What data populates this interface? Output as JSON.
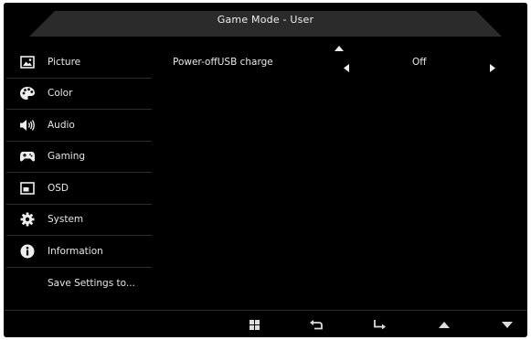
{
  "header": {
    "title": "Game Mode - User"
  },
  "sidebar": {
    "items": [
      {
        "label": "Picture",
        "icon": "picture-icon"
      },
      {
        "label": "Color",
        "icon": "palette-icon"
      },
      {
        "label": "Audio",
        "icon": "speaker-icon"
      },
      {
        "label": "Gaming",
        "icon": "gamepad-icon"
      },
      {
        "label": "OSD",
        "icon": "osd-icon"
      },
      {
        "label": "System",
        "icon": "gear-icon"
      },
      {
        "label": "Information",
        "icon": "info-icon"
      },
      {
        "label": "Save Settings to..."
      }
    ]
  },
  "content": {
    "setting": {
      "label": "Power-offUSB charge",
      "value": "Off"
    }
  },
  "footer": {
    "buttons": [
      "menu-grid-icon",
      "back-icon",
      "enter-icon",
      "up-arrow-icon",
      "down-arrow-icon"
    ]
  },
  "colors": {
    "background": "#000000",
    "text": "#e8e8e8",
    "header_bar": "#2a2a2a",
    "divider": "#2c2c2c"
  }
}
